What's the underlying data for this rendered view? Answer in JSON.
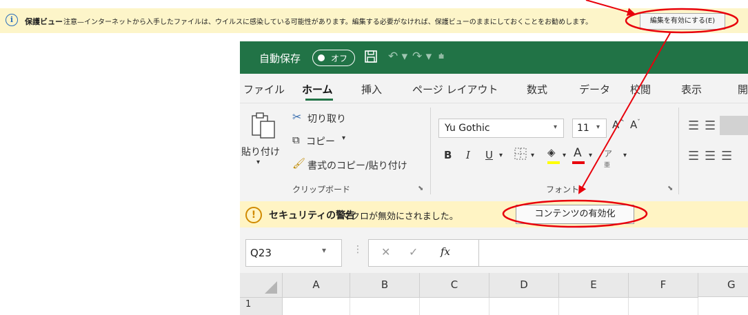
{
  "protected_view": {
    "title": "保護ビュー",
    "message": "注意—インターネットから入手したファイルは、ウイルスに感染している可能性があります。編集する必要がなければ、保護ビューのままにしておくことをお勧めします。",
    "enable_button": "編集を有効にする(E)"
  },
  "titlebar": {
    "autosave_label": "自動保存",
    "toggle_state": "オフ",
    "icons": [
      "save-icon",
      "undo-icon",
      "redo-icon",
      "qat-customize-icon"
    ]
  },
  "tabs": [
    "ファイル",
    "ホーム",
    "挿入",
    "ページ レイアウト",
    "数式",
    "データ",
    "校閲",
    "表示",
    "開"
  ],
  "active_tab": "ホーム",
  "clipboard": {
    "paste": "貼り付け",
    "cut": "切り取り",
    "copy": "コピー",
    "format_painter": "書式のコピー/貼り付け",
    "group_label": "クリップボード"
  },
  "font": {
    "name": "Yu Gothic",
    "size": "11",
    "group_label": "フォント",
    "bold": "B",
    "italic": "I",
    "underline": "U",
    "font_color_glyph": "A",
    "grow_font": "A",
    "shrink_font": "A"
  },
  "security": {
    "title": "セキュリティの警告",
    "message": "マクロが無効にされました。",
    "enable_button": "コンテンツの有効化"
  },
  "formula_bar": {
    "name_box": "Q23",
    "fx": "fx",
    "cancel": "✕",
    "enter": "✓",
    "formula": ""
  },
  "grid": {
    "columns": [
      "A",
      "B",
      "C",
      "D",
      "E",
      "F",
      "G"
    ],
    "rows": [
      "1"
    ]
  },
  "colors": {
    "excel_green": "#217346",
    "annotation_red": "#e8000b",
    "warning_yellow": "#fff4c4",
    "protected_yellow": "#fdf5c9"
  }
}
